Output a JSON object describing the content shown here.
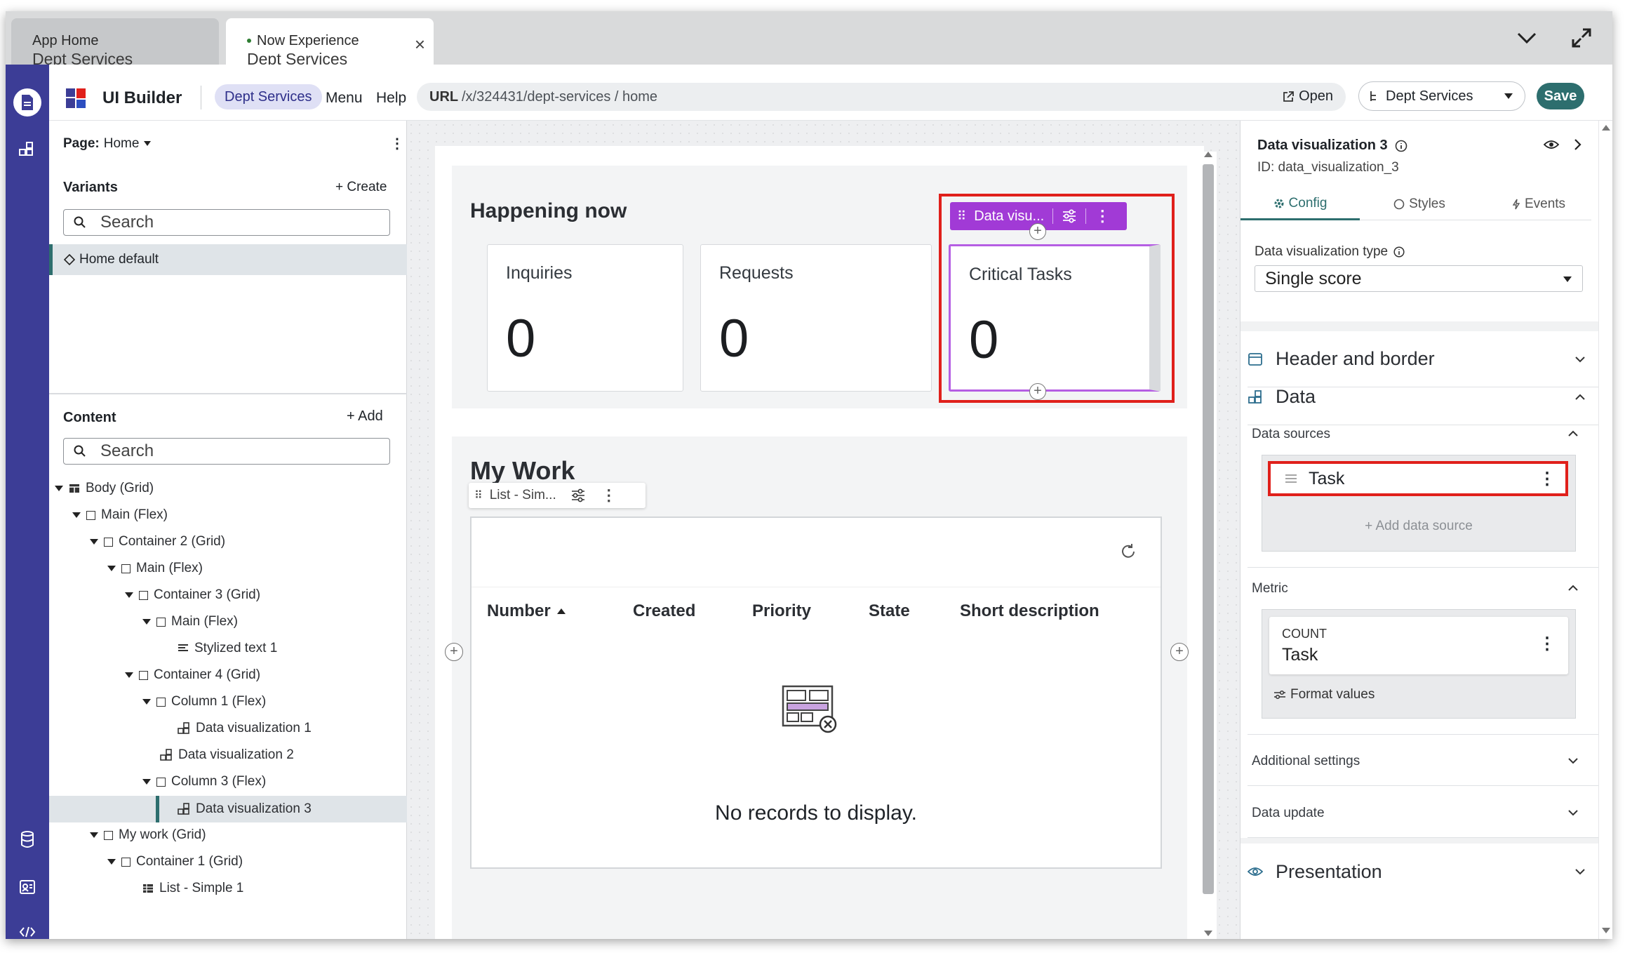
{
  "tabs": [
    {
      "app": "App Home",
      "name": "Dept Services"
    },
    {
      "app": "Now Experience",
      "name": "Dept Services"
    }
  ],
  "topbar": {
    "app_title": "UI Builder",
    "experience_pill": "Dept Services",
    "menu": "Menu",
    "help": "Help",
    "url_label": "URL",
    "url_value": "/x/324431/dept-services / home",
    "open_label": "Open",
    "experience_select": "Dept Services",
    "save_label": "Save"
  },
  "left_panel": {
    "page_label": "Page:",
    "page_value": "Home",
    "variants_label": "Variants",
    "create_label": "+ Create",
    "variants_search_placeholder": "Search",
    "variant_item": "Home default",
    "content_label": "Content",
    "add_label": "+ Add",
    "content_search_placeholder": "Search",
    "tree": [
      {
        "label": "Body (Grid)",
        "icon": "grid"
      },
      {
        "label": "Main (Flex)",
        "icon": "box"
      },
      {
        "label": "Container 2 (Grid)",
        "icon": "box"
      },
      {
        "label": "Main (Flex)",
        "icon": "box"
      },
      {
        "label": "Container 3 (Grid)",
        "icon": "box"
      },
      {
        "label": "Main (Flex)",
        "icon": "box"
      },
      {
        "label": "Stylized text 1",
        "icon": "text"
      },
      {
        "label": "Container 4 (Grid)",
        "icon": "box"
      },
      {
        "label": "Column 1 (Flex)",
        "icon": "box"
      },
      {
        "label": "Data visualization 1",
        "icon": "dataviz"
      },
      {
        "label": "Data visualization 2",
        "icon": "dataviz"
      },
      {
        "label": "Column 3 (Flex)",
        "icon": "box"
      },
      {
        "label": "Data visualization 3",
        "icon": "dataviz"
      },
      {
        "label": "My work (Grid)",
        "icon": "box"
      },
      {
        "label": "Container 1 (Grid)",
        "icon": "box"
      },
      {
        "label": "List - Simple 1",
        "icon": "list"
      }
    ]
  },
  "canvas": {
    "happening_title": "Happening now",
    "cards": [
      {
        "label": "Inquiries",
        "value": "0"
      },
      {
        "label": "Requests",
        "value": "0"
      },
      {
        "label": "Critical Tasks",
        "value": "0"
      }
    ],
    "dataviz_toolbar_label": "Data visu...",
    "my_work_title": "My Work",
    "list_toolbar_label": "List - Sim...",
    "columns": [
      "Number",
      "Created",
      "Priority",
      "State",
      "Short description"
    ],
    "empty_text": "No records to display."
  },
  "right_panel": {
    "component_title": "Data visualization 3",
    "component_id": "ID: data_visualization_3",
    "tabs": [
      "Config",
      "Styles",
      "Events"
    ],
    "type_label": "Data visualization type",
    "type_value": "Single score",
    "header_border": "Header and border",
    "data_section": "Data",
    "data_sources": "Data sources",
    "source_name": "Task",
    "add_source": "+ Add data source",
    "metric": "Metric",
    "metric_agg": "COUNT",
    "metric_table": "Task",
    "format_values": "Format values",
    "additional": "Additional settings",
    "data_update": "Data update",
    "presentation": "Presentation"
  },
  "colors": {
    "rail": "#3c3d96",
    "accent_purple": "#a13ad6",
    "highlight_red": "#e0201b",
    "save": "#2d6e6e"
  }
}
